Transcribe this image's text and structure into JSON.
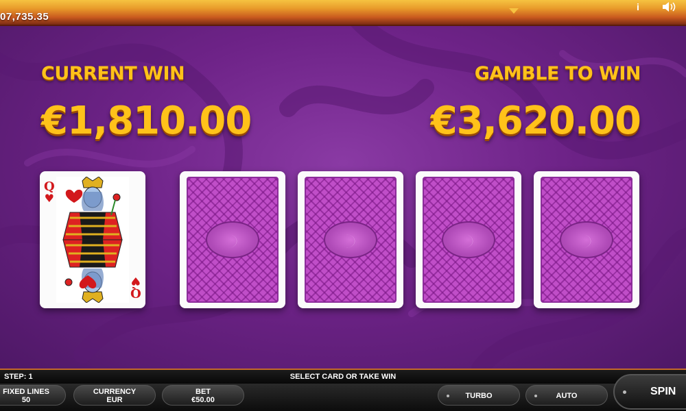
{
  "top_bar": {
    "balance": "07,735.35",
    "info_icon": "i",
    "sound_icon": "speaker-icon"
  },
  "win_panel": {
    "current_win_label": "CURRENT WIN",
    "current_win_amount": "€1,810.00",
    "gamble_label": "GAMBLE TO WIN",
    "gamble_amount": "€3,620.00"
  },
  "cards": {
    "dealer_card": {
      "rank": "Q",
      "suit": "♥",
      "suit_name": "hearts",
      "color": "#d2181c"
    },
    "choices": [
      {
        "state": "face-down"
      },
      {
        "state": "face-down"
      },
      {
        "state": "face-down"
      },
      {
        "state": "face-down"
      }
    ]
  },
  "status": {
    "step": "STEP: 1",
    "message": "SELECT CARD OR TAKE WIN"
  },
  "controls": {
    "fixed_lines_label": "FIXED LINES",
    "fixed_lines_value": "50",
    "currency_label": "CURRENCY",
    "currency_value": "EUR",
    "bet_label": "BET",
    "bet_value": "€50.00",
    "turbo_label": "TURBO",
    "auto_label": "AUTO",
    "spin_label": "SPIN"
  },
  "colors": {
    "gold_text": "#ffc21a",
    "field_purple": "#6e2388",
    "card_back": "#c04ec8"
  }
}
